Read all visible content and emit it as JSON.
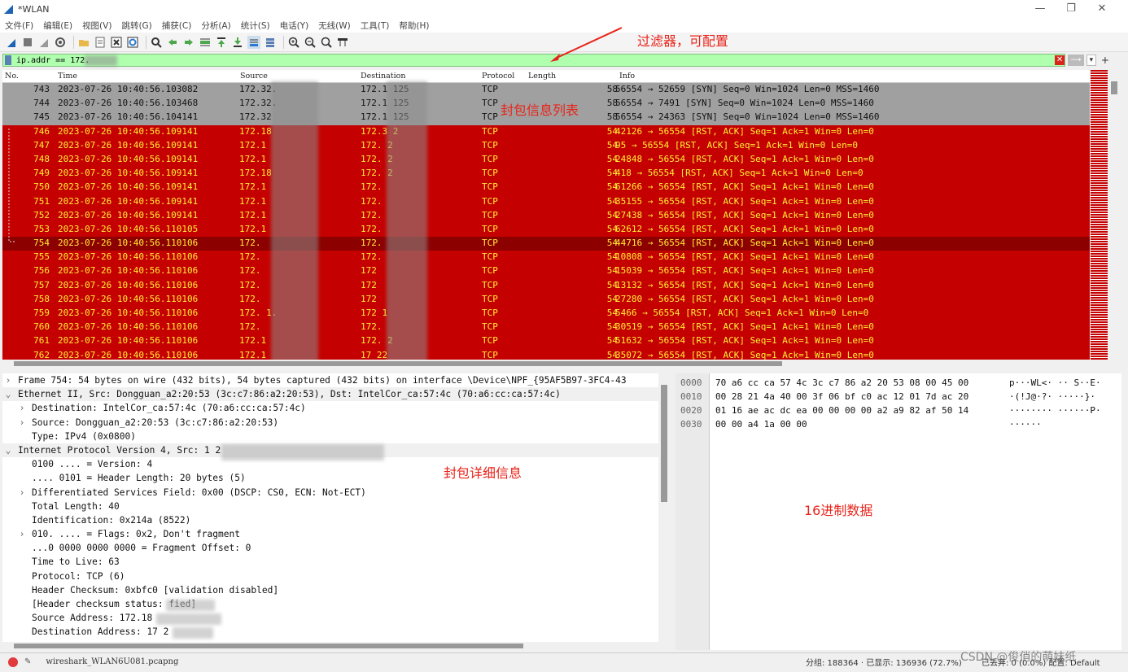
{
  "window": {
    "title": "*WLAN",
    "controls": [
      "—",
      "❐",
      "✕"
    ]
  },
  "menu": [
    "文件(F)",
    "编辑(E)",
    "视图(V)",
    "跳转(G)",
    "捕获(C)",
    "分析(A)",
    "统计(S)",
    "电话(Y)",
    "无线(W)",
    "工具(T)",
    "帮助(H)"
  ],
  "filter": {
    "value": "ip.addr == 172.",
    "clear": "✕",
    "apply": "⟶",
    "dropdown": "▾",
    "add": "+"
  },
  "columns": {
    "no": "No.",
    "time": "Time",
    "source": "Source",
    "destination": "Destination",
    "protocol": "Protocol",
    "length": "Length",
    "info": "Info"
  },
  "packets": [
    {
      "no": "743",
      "time": "2023-07-26 10:40:56.103082",
      "src": "172.32.",
      "dst": "172.1   125",
      "proto": "TCP",
      "len": "58",
      "info": "56554 → 52659 [SYN] Seq=0 Win=1024 Len=0 MSS=1460"
    },
    {
      "no": "744",
      "time": "2023-07-26 10:40:56.103468",
      "src": "172.32.",
      "dst": "172.1   125",
      "proto": "TCP",
      "len": "58",
      "info": "56554 → 7491 [SYN] Seq=0 Win=1024 Len=0 MSS=1460"
    },
    {
      "no": "745",
      "time": "2023-07-26 10:40:56.104141",
      "src": "172.32",
      "dst": "172.1   125",
      "proto": "TCP",
      "len": "58",
      "info": "56554 → 24363 [SYN] Seq=0 Win=1024 Len=0 MSS=1460"
    },
    {
      "no": "746",
      "time": "2023-07-26 10:40:56.109141",
      "src": "172.18",
      "dst": "172.3     2",
      "proto": "TCP",
      "len": "54",
      "info": "42126 → 56554 [RST, ACK] Seq=1 Ack=1 Win=0 Len=0"
    },
    {
      "no": "747",
      "time": "2023-07-26 10:40:56.109141",
      "src": "172.1",
      "dst": "172.      2",
      "proto": "TCP",
      "len": "54",
      "info": "95 → 56554 [RST, ACK] Seq=1 Ack=1 Win=0 Len=0"
    },
    {
      "no": "748",
      "time": "2023-07-26 10:40:56.109141",
      "src": "172.1",
      "dst": "172.      2",
      "proto": "TCP",
      "len": "54",
      "info": "24848 → 56554 [RST, ACK] Seq=1 Ack=1 Win=0 Len=0"
    },
    {
      "no": "749",
      "time": "2023-07-26 10:40:56.109141",
      "src": "172.18",
      "dst": "172.      2",
      "proto": "TCP",
      "len": "54",
      "info": "418 → 56554 [RST, ACK] Seq=1 Ack=1 Win=0 Len=0"
    },
    {
      "no": "750",
      "time": "2023-07-26 10:40:56.109141",
      "src": "172.1",
      "dst": "172.",
      "proto": "TCP",
      "len": "54",
      "info": "61266 → 56554 [RST, ACK] Seq=1 Ack=1 Win=0 Len=0"
    },
    {
      "no": "751",
      "time": "2023-07-26 10:40:56.109141",
      "src": "172.1",
      "dst": "172.",
      "proto": "TCP",
      "len": "54",
      "info": "35155 → 56554 [RST, ACK] Seq=1 Ack=1 Win=0 Len=0"
    },
    {
      "no": "752",
      "time": "2023-07-26 10:40:56.109141",
      "src": "172.1",
      "dst": "172.",
      "proto": "TCP",
      "len": "54",
      "info": "27438 → 56554 [RST, ACK] Seq=1 Ack=1 Win=0 Len=0"
    },
    {
      "no": "753",
      "time": "2023-07-26 10:40:56.110105",
      "src": "172.1",
      "dst": "172.",
      "proto": "TCP",
      "len": "54",
      "info": "62612 → 56554 [RST, ACK] Seq=1 Ack=1 Win=0 Len=0"
    },
    {
      "no": "754",
      "time": "2023-07-26 10:40:56.110106",
      "src": "172.",
      "dst": "172.",
      "proto": "TCP",
      "len": "54",
      "info": "44716 → 56554 [RST, ACK] Seq=1 Ack=1 Win=0 Len=0"
    },
    {
      "no": "755",
      "time": "2023-07-26 10:40:56.110106",
      "src": "172.",
      "dst": "172.",
      "proto": "TCP",
      "len": "54",
      "info": "10808 → 56554 [RST, ACK] Seq=1 Ack=1 Win=0 Len=0"
    },
    {
      "no": "756",
      "time": "2023-07-26 10:40:56.110106",
      "src": "172.",
      "dst": "172",
      "proto": "TCP",
      "len": "54",
      "info": "15039 → 56554 [RST, ACK] Seq=1 Ack=1 Win=0 Len=0"
    },
    {
      "no": "757",
      "time": "2023-07-26 10:40:56.110106",
      "src": "172.",
      "dst": "172",
      "proto": "TCP",
      "len": "54",
      "info": "13132 → 56554 [RST, ACK] Seq=1 Ack=1 Win=0 Len=0"
    },
    {
      "no": "758",
      "time": "2023-07-26 10:40:56.110106",
      "src": "172.",
      "dst": "172",
      "proto": "TCP",
      "len": "54",
      "info": "27280 → 56554 [RST, ACK] Seq=1 Ack=1 Win=0 Len=0"
    },
    {
      "no": "759",
      "time": "2023-07-26 10:40:56.110106",
      "src": "172.     1.",
      "dst": "172     1",
      "proto": "TCP",
      "len": "54",
      "info": "5466 → 56554 [RST, ACK] Seq=1 Ack=1 Win=0 Len=0"
    },
    {
      "no": "760",
      "time": "2023-07-26 10:40:56.110106",
      "src": "172.",
      "dst": "172.",
      "proto": "TCP",
      "len": "54",
      "info": "30519 → 56554 [RST, ACK] Seq=1 Ack=1 Win=0 Len=0"
    },
    {
      "no": "761",
      "time": "2023-07-26 10:40:56.110106",
      "src": "172.1",
      "dst": "172.      2",
      "proto": "TCP",
      "len": "54",
      "info": "51632 → 56554 [RST, ACK] Seq=1 Ack=1 Win=0 Len=0"
    },
    {
      "no": "762",
      "time": "2023-07-26 10:40:56.110106",
      "src": "172.1",
      "dst": "17      22",
      "proto": "TCP",
      "len": "54",
      "info": "35072 → 56554 [RST, ACK] Seq=1 Ack=1 Win=0 Len=0"
    }
  ],
  "detail": [
    {
      "arrow": "›",
      "indent": 0,
      "text": "Frame 754: 54 bytes on wire (432 bits), 54 bytes captured (432 bits) on interface \\Device\\NPF_{95AF5B97-3FC4-43"
    },
    {
      "arrow": "⌄",
      "indent": 0,
      "text": "Ethernet II, Src: Dongguan_a2:20:53 (3c:c7:86:a2:20:53), Dst: IntelCor_ca:57:4c (70:a6:cc:ca:57:4c)"
    },
    {
      "arrow": "›",
      "indent": 1,
      "text": "Destination: IntelCor_ca:57:4c (70:a6:cc:ca:57:4c)"
    },
    {
      "arrow": "›",
      "indent": 1,
      "text": "Source: Dongguan_a2:20:53 (3c:c7:86:a2:20:53)"
    },
    {
      "arrow": "",
      "indent": 1,
      "text": "Type: IPv4 (0x0800)"
    },
    {
      "arrow": "⌄",
      "indent": 0,
      "text": "Internet Protocol Version 4, Src: 1                  2"
    },
    {
      "arrow": "",
      "indent": 1,
      "text": "0100 .... = Version: 4"
    },
    {
      "arrow": "",
      "indent": 1,
      "text": ".... 0101 = Header Length: 20 bytes (5)"
    },
    {
      "arrow": "›",
      "indent": 1,
      "text": "Differentiated Services Field: 0x00 (DSCP: CS0, ECN: Not-ECT)"
    },
    {
      "arrow": "",
      "indent": 1,
      "text": "Total Length: 40"
    },
    {
      "arrow": "",
      "indent": 1,
      "text": "Identification: 0x214a (8522)"
    },
    {
      "arrow": "›",
      "indent": 1,
      "text": "010. .... = Flags: 0x2, Don't fragment"
    },
    {
      "arrow": "",
      "indent": 1,
      "text": "...0 0000 0000 0000 = Fragment Offset: 0"
    },
    {
      "arrow": "",
      "indent": 1,
      "text": "Time to Live: 63"
    },
    {
      "arrow": "",
      "indent": 1,
      "text": "Protocol: TCP (6)"
    },
    {
      "arrow": "",
      "indent": 1,
      "text": "Header Checksum: 0xbfc0 [validation disabled]"
    },
    {
      "arrow": "",
      "indent": 1,
      "text": "[Header checksum status:      fied]"
    },
    {
      "arrow": "",
      "indent": 1,
      "text": "Source Address: 172.18"
    },
    {
      "arrow": "",
      "indent": 1,
      "text": "Destination Address: 17        2"
    }
  ],
  "hex": [
    {
      "off": "0000",
      "bytes": "70 a6 cc ca 57 4c 3c c7  86 a2 20 53 08 00 45 00",
      "ascii": "p···WL<· ·· S··E·"
    },
    {
      "off": "0010",
      "bytes": "00 28 21 4a 40 00 3f 06  bf c0 ac 12 01 7d ac 20",
      "ascii": "·(!J@·?· ·····}· "
    },
    {
      "off": "0020",
      "bytes": "01 16 ae ac dc ea 00 00  00 00 a2 a9 82 af 50 14",
      "ascii": "········ ······P·"
    },
    {
      "off": "0030",
      "bytes": "00 00 a4 1a 00 00",
      "ascii": "······"
    }
  ],
  "status": {
    "file": "wireshark_WLAN6U081.pcapng",
    "groups": "分组: 188364 · 已显示: 136936 (72.7%)",
    "profile": "已丢弃: 0 (0.0%)  配置: Default"
  },
  "annotations": {
    "filter_note": "过滤器，可配置",
    "list_note": "封包信息列表",
    "detail_note": "封包详细信息",
    "hex_note": "16进制数据"
  },
  "watermark": "CSDN @俊俏的萌妹纸",
  "colors": {
    "syn_row": "#a0a0a0",
    "rst_row": "#c40000",
    "selected_row": "#8c0000",
    "rst_text": "#ffef36",
    "annotation": "#e8231a",
    "filter_bg": "#afffaf"
  }
}
